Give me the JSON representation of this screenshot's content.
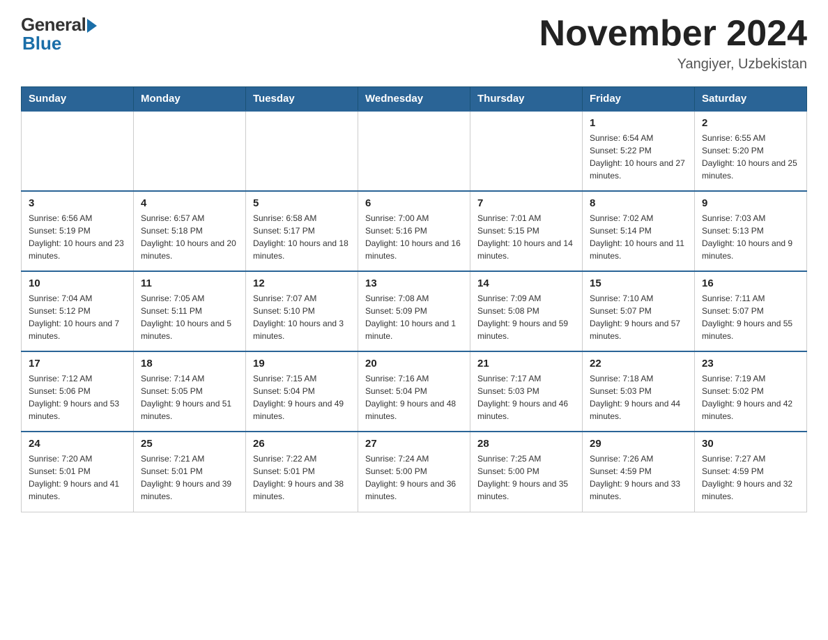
{
  "header": {
    "logo_general": "General",
    "logo_blue": "Blue",
    "month_title": "November 2024",
    "location": "Yangiyer, Uzbekistan"
  },
  "days_of_week": [
    "Sunday",
    "Monday",
    "Tuesday",
    "Wednesday",
    "Thursday",
    "Friday",
    "Saturday"
  ],
  "weeks": [
    [
      {
        "day": "",
        "info": ""
      },
      {
        "day": "",
        "info": ""
      },
      {
        "day": "",
        "info": ""
      },
      {
        "day": "",
        "info": ""
      },
      {
        "day": "",
        "info": ""
      },
      {
        "day": "1",
        "info": "Sunrise: 6:54 AM\nSunset: 5:22 PM\nDaylight: 10 hours and 27 minutes."
      },
      {
        "day": "2",
        "info": "Sunrise: 6:55 AM\nSunset: 5:20 PM\nDaylight: 10 hours and 25 minutes."
      }
    ],
    [
      {
        "day": "3",
        "info": "Sunrise: 6:56 AM\nSunset: 5:19 PM\nDaylight: 10 hours and 23 minutes."
      },
      {
        "day": "4",
        "info": "Sunrise: 6:57 AM\nSunset: 5:18 PM\nDaylight: 10 hours and 20 minutes."
      },
      {
        "day": "5",
        "info": "Sunrise: 6:58 AM\nSunset: 5:17 PM\nDaylight: 10 hours and 18 minutes."
      },
      {
        "day": "6",
        "info": "Sunrise: 7:00 AM\nSunset: 5:16 PM\nDaylight: 10 hours and 16 minutes."
      },
      {
        "day": "7",
        "info": "Sunrise: 7:01 AM\nSunset: 5:15 PM\nDaylight: 10 hours and 14 minutes."
      },
      {
        "day": "8",
        "info": "Sunrise: 7:02 AM\nSunset: 5:14 PM\nDaylight: 10 hours and 11 minutes."
      },
      {
        "day": "9",
        "info": "Sunrise: 7:03 AM\nSunset: 5:13 PM\nDaylight: 10 hours and 9 minutes."
      }
    ],
    [
      {
        "day": "10",
        "info": "Sunrise: 7:04 AM\nSunset: 5:12 PM\nDaylight: 10 hours and 7 minutes."
      },
      {
        "day": "11",
        "info": "Sunrise: 7:05 AM\nSunset: 5:11 PM\nDaylight: 10 hours and 5 minutes."
      },
      {
        "day": "12",
        "info": "Sunrise: 7:07 AM\nSunset: 5:10 PM\nDaylight: 10 hours and 3 minutes."
      },
      {
        "day": "13",
        "info": "Sunrise: 7:08 AM\nSunset: 5:09 PM\nDaylight: 10 hours and 1 minute."
      },
      {
        "day": "14",
        "info": "Sunrise: 7:09 AM\nSunset: 5:08 PM\nDaylight: 9 hours and 59 minutes."
      },
      {
        "day": "15",
        "info": "Sunrise: 7:10 AM\nSunset: 5:07 PM\nDaylight: 9 hours and 57 minutes."
      },
      {
        "day": "16",
        "info": "Sunrise: 7:11 AM\nSunset: 5:07 PM\nDaylight: 9 hours and 55 minutes."
      }
    ],
    [
      {
        "day": "17",
        "info": "Sunrise: 7:12 AM\nSunset: 5:06 PM\nDaylight: 9 hours and 53 minutes."
      },
      {
        "day": "18",
        "info": "Sunrise: 7:14 AM\nSunset: 5:05 PM\nDaylight: 9 hours and 51 minutes."
      },
      {
        "day": "19",
        "info": "Sunrise: 7:15 AM\nSunset: 5:04 PM\nDaylight: 9 hours and 49 minutes."
      },
      {
        "day": "20",
        "info": "Sunrise: 7:16 AM\nSunset: 5:04 PM\nDaylight: 9 hours and 48 minutes."
      },
      {
        "day": "21",
        "info": "Sunrise: 7:17 AM\nSunset: 5:03 PM\nDaylight: 9 hours and 46 minutes."
      },
      {
        "day": "22",
        "info": "Sunrise: 7:18 AM\nSunset: 5:03 PM\nDaylight: 9 hours and 44 minutes."
      },
      {
        "day": "23",
        "info": "Sunrise: 7:19 AM\nSunset: 5:02 PM\nDaylight: 9 hours and 42 minutes."
      }
    ],
    [
      {
        "day": "24",
        "info": "Sunrise: 7:20 AM\nSunset: 5:01 PM\nDaylight: 9 hours and 41 minutes."
      },
      {
        "day": "25",
        "info": "Sunrise: 7:21 AM\nSunset: 5:01 PM\nDaylight: 9 hours and 39 minutes."
      },
      {
        "day": "26",
        "info": "Sunrise: 7:22 AM\nSunset: 5:01 PM\nDaylight: 9 hours and 38 minutes."
      },
      {
        "day": "27",
        "info": "Sunrise: 7:24 AM\nSunset: 5:00 PM\nDaylight: 9 hours and 36 minutes."
      },
      {
        "day": "28",
        "info": "Sunrise: 7:25 AM\nSunset: 5:00 PM\nDaylight: 9 hours and 35 minutes."
      },
      {
        "day": "29",
        "info": "Sunrise: 7:26 AM\nSunset: 4:59 PM\nDaylight: 9 hours and 33 minutes."
      },
      {
        "day": "30",
        "info": "Sunrise: 7:27 AM\nSunset: 4:59 PM\nDaylight: 9 hours and 32 minutes."
      }
    ]
  ]
}
